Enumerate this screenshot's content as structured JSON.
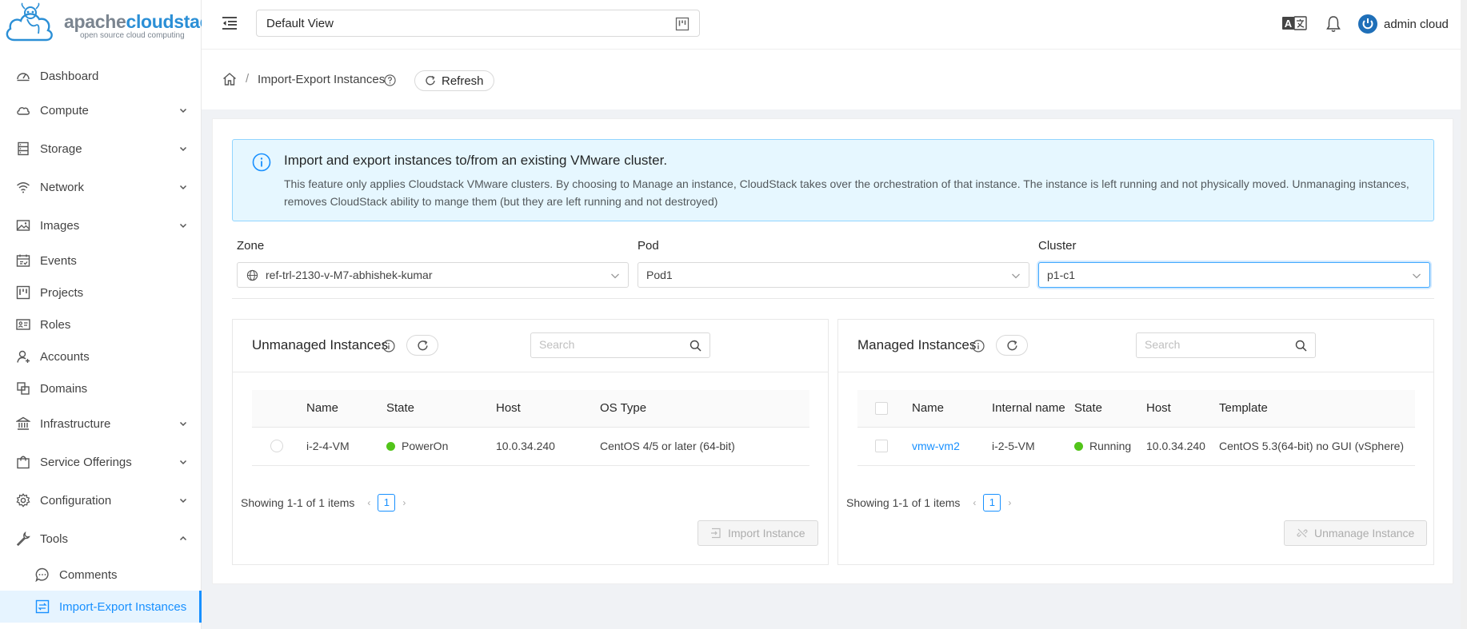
{
  "brand": {
    "name_a": "apache",
    "name_b": "cloudstack",
    "tagline": "open source cloud computing"
  },
  "sidebar": {
    "items": [
      {
        "label": "Dashboard",
        "icon": "dashboard-icon"
      },
      {
        "label": "Compute",
        "icon": "cloud-icon",
        "expandable": true
      },
      {
        "label": "Storage",
        "icon": "database-icon",
        "expandable": true
      },
      {
        "label": "Network",
        "icon": "wifi-icon",
        "expandable": true
      },
      {
        "label": "Images",
        "icon": "picture-icon",
        "expandable": true
      },
      {
        "label": "Events",
        "icon": "schedule-icon"
      },
      {
        "label": "Projects",
        "icon": "project-icon"
      },
      {
        "label": "Roles",
        "icon": "idcard-icon"
      },
      {
        "label": "Accounts",
        "icon": "team-icon"
      },
      {
        "label": "Domains",
        "icon": "block-icon"
      },
      {
        "label": "Infrastructure",
        "icon": "bank-icon",
        "expandable": true
      },
      {
        "label": "Service Offerings",
        "icon": "shopping-icon",
        "expandable": true
      },
      {
        "label": "Configuration",
        "icon": "setting-icon",
        "expandable": true
      },
      {
        "label": "Tools",
        "icon": "tool-icon",
        "expanded": true
      },
      {
        "label": "Comments",
        "icon": "message-icon"
      },
      {
        "label": "Import-Export Instances",
        "icon": "interaction-icon",
        "active": true
      }
    ]
  },
  "header": {
    "view_select": "Default View",
    "user_name": "admin cloud"
  },
  "breadcrumb": {
    "title": "Import-Export Instances",
    "refresh_label": "Refresh"
  },
  "alert": {
    "title": "Import and export instances to/from an existing VMware cluster.",
    "description": "This feature only applies Cloudstack VMware clusters. By choosing to Manage an instance, CloudStack takes over the orchestration of that instance. The instance is left running and not physically moved. Unmanaging instances, removes CloudStack ability to mange them (but they are left running and not destroyed)"
  },
  "filters": {
    "zone_label": "Zone",
    "zone_value": "ref-trl-2130-v-M7-abhishek-kumar",
    "pod_label": "Pod",
    "pod_value": "Pod1",
    "cluster_label": "Cluster",
    "cluster_value": "p1-c1"
  },
  "unmanaged": {
    "title": "Unmanaged Instances",
    "search_placeholder": "Search",
    "columns": [
      "Name",
      "State",
      "Host",
      "OS Type"
    ],
    "rows": [
      {
        "name": "i-2-4-VM",
        "state": "PowerOn",
        "host": "10.0.34.240",
        "os_type": "CentOS 4/5 or later (64-bit)"
      }
    ],
    "showing": "Showing 1-1 of 1 items",
    "page": "1",
    "action_label": "Import Instance"
  },
  "managed": {
    "title": "Managed Instances",
    "search_placeholder": "Search",
    "columns": [
      "Name",
      "Internal name",
      "State",
      "Host",
      "Template"
    ],
    "rows": [
      {
        "name": "vmw-vm2",
        "internal_name": "i-2-5-VM",
        "state": "Running",
        "host": "10.0.34.240",
        "template": "CentOS 5.3(64-bit) no GUI (vSphere)"
      }
    ],
    "showing": "Showing 1-1 of 1 items",
    "page": "1",
    "action_label": "Unmanage Instance"
  },
  "colors": {
    "accent": "#1890ff",
    "status_ok": "#52c41a",
    "alert_bg": "#e6f7ff"
  }
}
